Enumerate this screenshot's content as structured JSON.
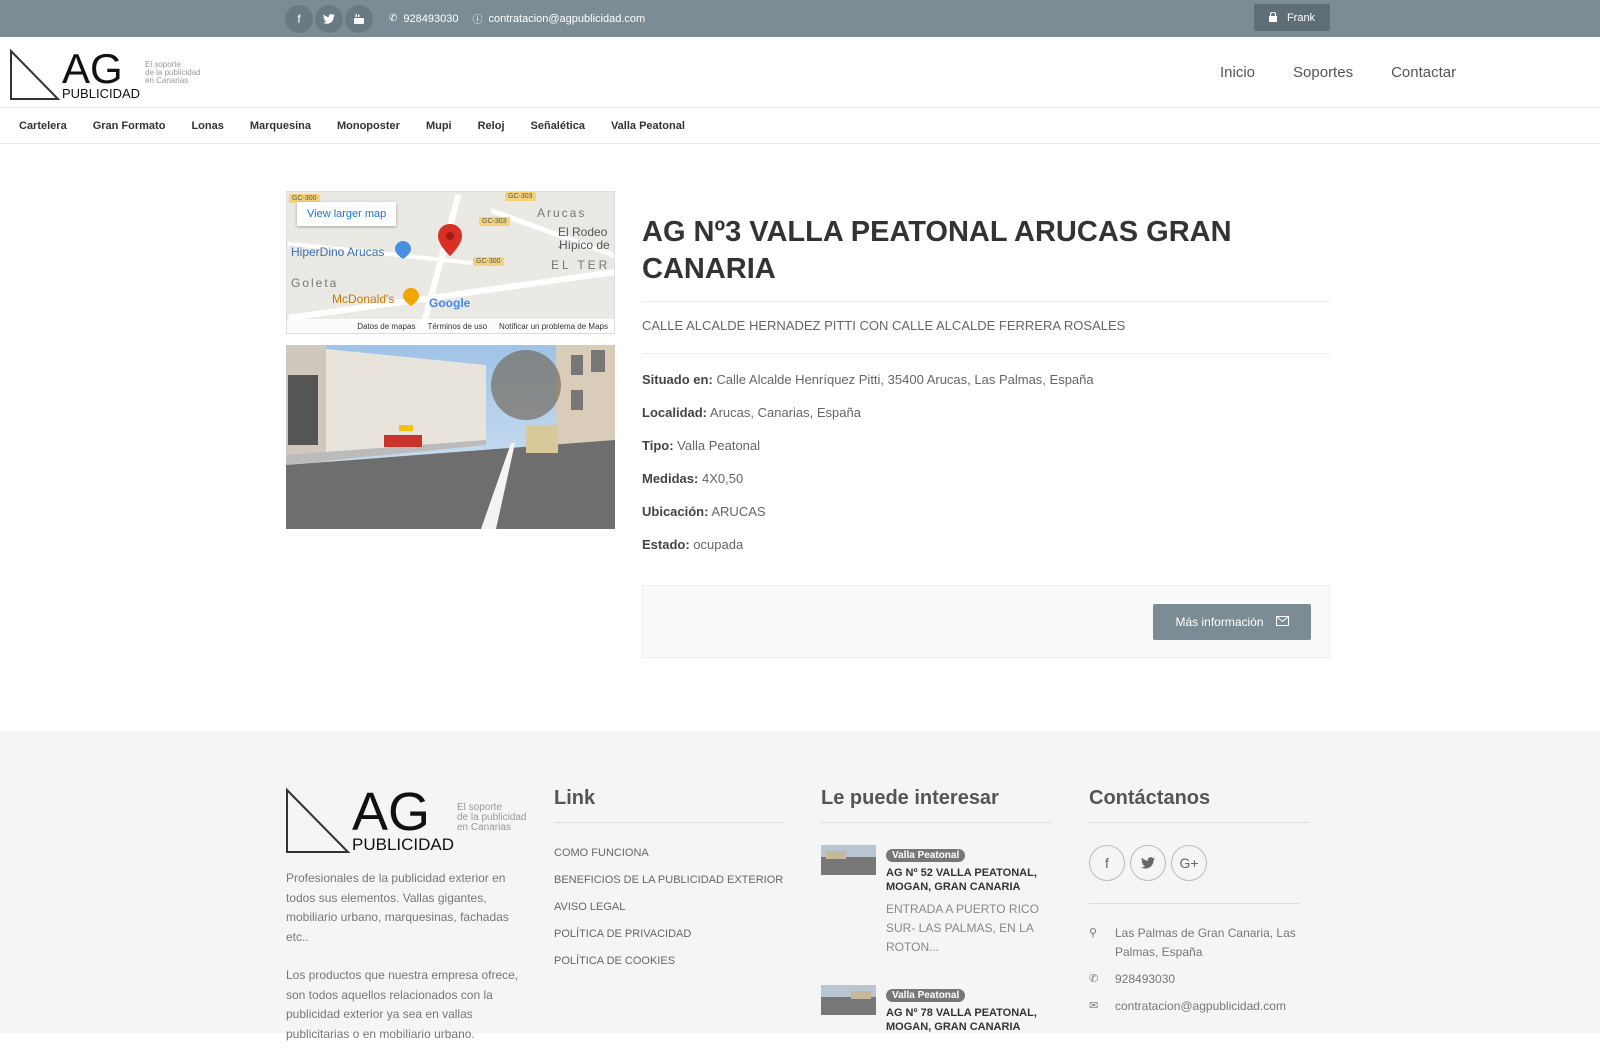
{
  "topbar": {
    "social": [
      "facebook-icon",
      "twitter-icon",
      "youtube-icon"
    ],
    "phone": "928493030",
    "email": "contratacion@agpublicidad.com",
    "login_label": "Frank"
  },
  "header": {
    "logo": {
      "big": "AG",
      "word": "PUBLICIDAD",
      "tagline_1": "El soporte",
      "tagline_2": "de la publicidad",
      "tagline_3": "en Canarias"
    },
    "nav": [
      "Inicio",
      "Soportes",
      "Contactar"
    ]
  },
  "categories": [
    "Cartelera",
    "Gran Formato",
    "Lonas",
    "Marquesina",
    "Monoposter",
    "Mupi",
    "Reloj",
    "Señalética",
    "Valla Peatonal"
  ],
  "map": {
    "larger_link": "View larger map",
    "labels": [
      "Arucas",
      "El Rodeo -",
      "Hípico de",
      "HiperDino Arucas",
      "EL TER",
      "Goleta",
      "McDonald's",
      "Google"
    ],
    "road_tags": [
      "GC-300",
      "GC-303",
      "GC-303",
      "GC-300"
    ],
    "footer": [
      "Datos de mapas",
      "Términos de uso",
      "Notificar un problema de Maps"
    ]
  },
  "listing": {
    "title": "AG Nº3 VALLA PEATONAL ARUCAS GRAN CANARIA",
    "subtitle": "CALLE ALCALDE HERNADEZ PITTI CON CALLE ALCALDE FERRERA ROSALES",
    "specs": [
      {
        "label": "Situado en:",
        "value": "Calle Alcalde Henríquez Pitti, 35400 Arucas, Las Palmas, España"
      },
      {
        "label": "Localidad:",
        "value": "Arucas, Canarias, España"
      },
      {
        "label": "Tipo:",
        "value": "Valla Peatonal"
      },
      {
        "label": "Medidas:",
        "value": "4X0,50"
      },
      {
        "label": "Ubicación:",
        "value": "ARUCAS"
      },
      {
        "label": "Estado:",
        "value": "ocupada"
      }
    ],
    "more_button": "Más información"
  },
  "footer": {
    "about": [
      "Profesionales de la publicidad exterior en todos sus elementos. Vallas gigantes, mobiliario urbano, marquesinas, fachadas etc..",
      "Los productos que nuestra empresa ofrece, son todos aquellos relacionados con la publicidad exterior ya sea en vallas publicitarias o en mobiliario urbano."
    ],
    "links_title": "Link",
    "links": [
      "COMO FUNCIONA",
      "BENEFICIOS DE LA PUBLICIDAD EXTERIOR",
      "AVISO LEGAL",
      "POLÍTICA DE PRIVACIDAD",
      "POLÍTICA DE COOKIES"
    ],
    "interest_title": "Le puede interesar",
    "posts": [
      {
        "badge": "Valla Peatonal",
        "title": "AG Nº 52 VALLA PEATONAL, MOGAN, GRAN CANARIA",
        "excerpt": "ENTRADA A PUERTO RICO SUR- LAS PALMAS, EN LA ROTON..."
      },
      {
        "badge": "Valla Peatonal",
        "title": "AG Nº 78 VALLA PEATONAL, MOGAN, GRAN CANARIA",
        "excerpt": ""
      }
    ],
    "contact_title": "Contáctanos",
    "contact_social": [
      "facebook-icon",
      "twitter-icon",
      "google-plus-icon"
    ],
    "address": "Las Palmas de Gran Canaria, Las Palmas, España",
    "phone": "928493030",
    "email": "contratacion@agpublicidad.com"
  }
}
